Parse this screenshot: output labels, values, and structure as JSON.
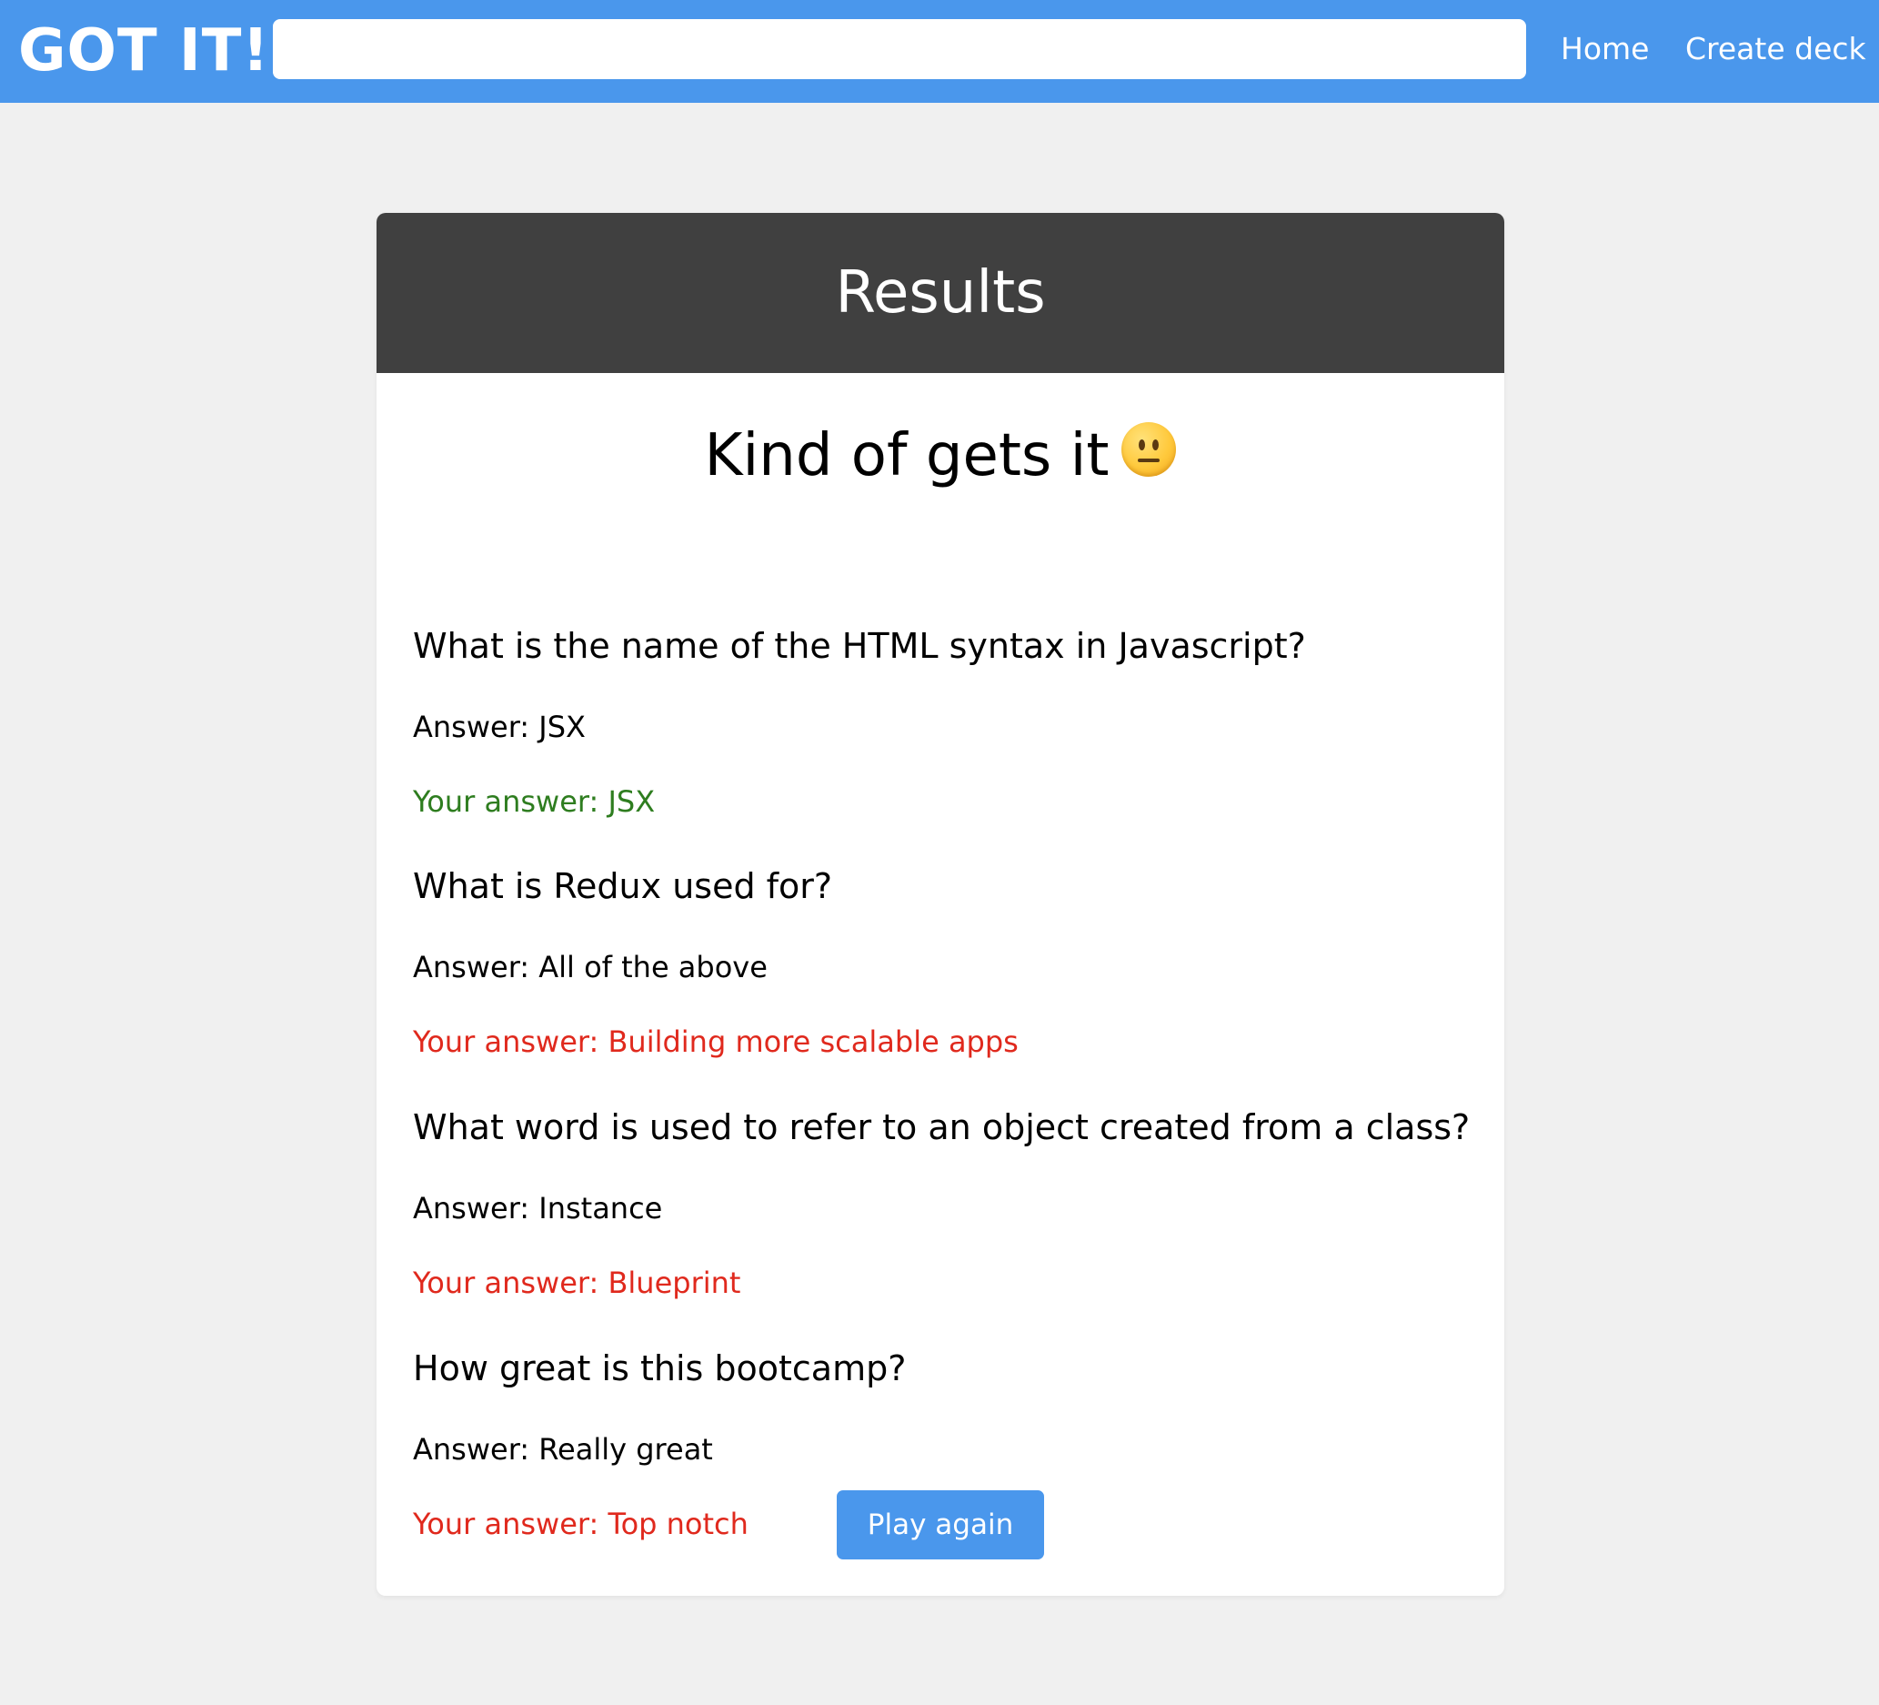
{
  "navbar": {
    "logo": "GOT IT!",
    "search": {
      "value": "",
      "placeholder": ""
    },
    "links": {
      "home": "Home",
      "create_deck": "Create deck"
    },
    "color": "#4a97ec"
  },
  "results": {
    "title": "Results",
    "verdict": "Kind of gets it",
    "verdict_icon": "neutral-face-icon",
    "questions": [
      {
        "question": "What is the name of the HTML syntax in Javascript?",
        "answer": "Answer: JSX",
        "your_answer": "Your answer: JSX",
        "correct": true
      },
      {
        "question": "What is Redux used for?",
        "answer": "Answer: All of the above",
        "your_answer": "Your answer: Building more scalable apps",
        "correct": false
      },
      {
        "question": "What word is used to refer to an object created from a class?",
        "answer": "Answer: Instance",
        "your_answer": "Your answer: Blueprint",
        "correct": false
      },
      {
        "question": "How great is this bootcamp?",
        "answer": "Answer: Really great",
        "your_answer": "Your answer: Top notch",
        "correct": false
      }
    ],
    "play_again_label": "Play again",
    "colors": {
      "header_bg": "#404040",
      "correct": "#2e7d1f",
      "wrong": "#e0291d"
    }
  }
}
